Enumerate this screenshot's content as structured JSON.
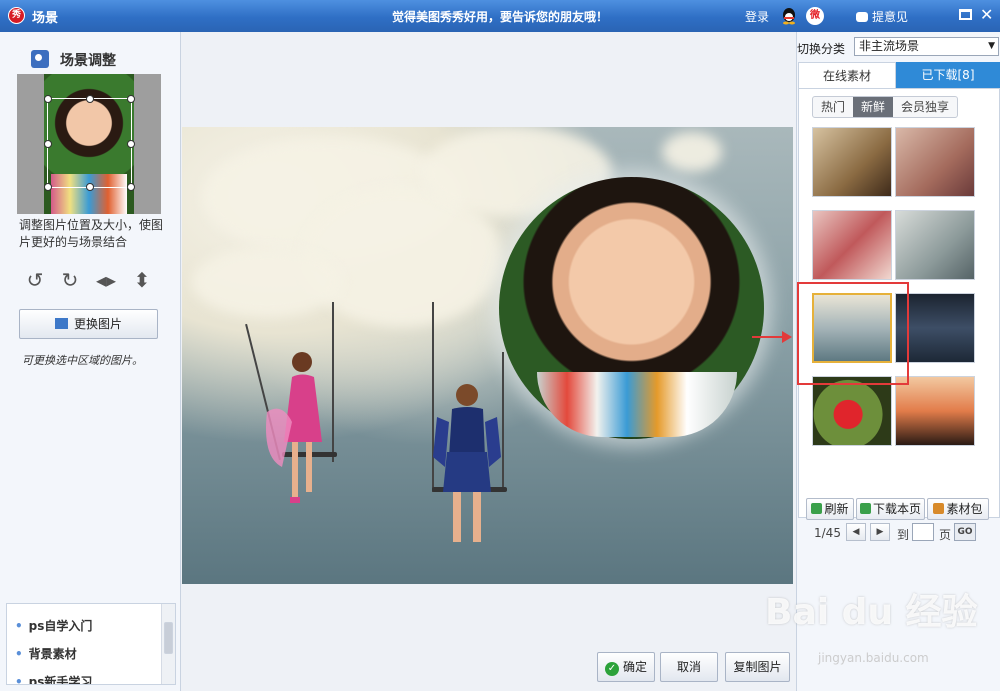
{
  "titlebar": {
    "title": "场景",
    "slogan": "觉得美图秀秀好用，要告诉您的朋友哦！",
    "login": "登录",
    "feedback": "提意见"
  },
  "left": {
    "title": "场景调整",
    "hint": "调整图片位置及大小，使图片更好的与场景结合",
    "change_button": "更换图片",
    "note": "可更换选中区域的图片。",
    "related": [
      "ps自学入门",
      "背景素材",
      "ps新手学习"
    ]
  },
  "main": {
    "ok_label": "确定",
    "cancel_label": "取消",
    "copy_label": "复制图片"
  },
  "right": {
    "category_label": "切换分类",
    "category_value": "非主流场景",
    "tab_online": "在线素材",
    "tab_downloaded": "已下载[8]",
    "subtabs": [
      "热门",
      "新鲜",
      "会员独享"
    ],
    "active_subtab": "新鲜",
    "pager": {
      "current": "1/45",
      "goto_label": "到",
      "page_label": "页",
      "go_label": "GO"
    },
    "refresh_label": "刷新",
    "download_page_label": "下载本页",
    "material_pack_label": "素材包"
  },
  "watermark": {
    "brand": "Bai du 经验",
    "url": "jingyan.baidu.com"
  },
  "colors": {
    "titlebar": "#2f6fc5",
    "tab_active": "#2f8ad7",
    "highlight": "#e33a3a",
    "selected_thumb": "#e6b13a"
  }
}
